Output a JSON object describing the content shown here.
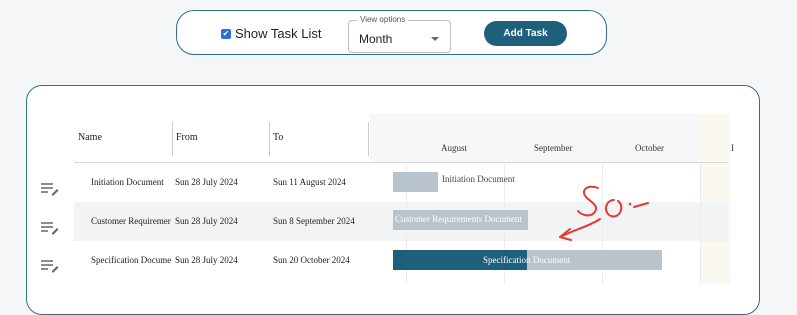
{
  "controls": {
    "show_task_list_label": "Show Task List",
    "show_task_list_checked": true,
    "view_options_legend": "View options",
    "view_options_value": "Month",
    "add_task_label": "Add Task"
  },
  "table": {
    "columns": [
      "Name",
      "From",
      "To"
    ],
    "months": [
      "August",
      "September",
      "October",
      "I"
    ],
    "rows": [
      {
        "name": "Initiation Document",
        "from": "Sun 28 July 2024",
        "to": "Sun 11 August 2024",
        "bar_label": "Initiation Document",
        "progress": 0
      },
      {
        "name": "Customer Requiremer",
        "from": "Sun 28 July 2024",
        "to": "Sun 8 September 2024",
        "bar_label": "Customer Requirements Document",
        "progress": 0
      },
      {
        "name": "Specification Docume",
        "from": "Sun 28 July 2024",
        "to": "Sun 20 October 2024",
        "bar_label": "Specification Document",
        "progress": 0.5
      }
    ]
  },
  "annotation": {
    "text": "SO:",
    "color": "#e53935"
  },
  "colors": {
    "accent": "#1e5f7b",
    "bar": "#b9c3cc",
    "border": "#2f6f8a"
  }
}
